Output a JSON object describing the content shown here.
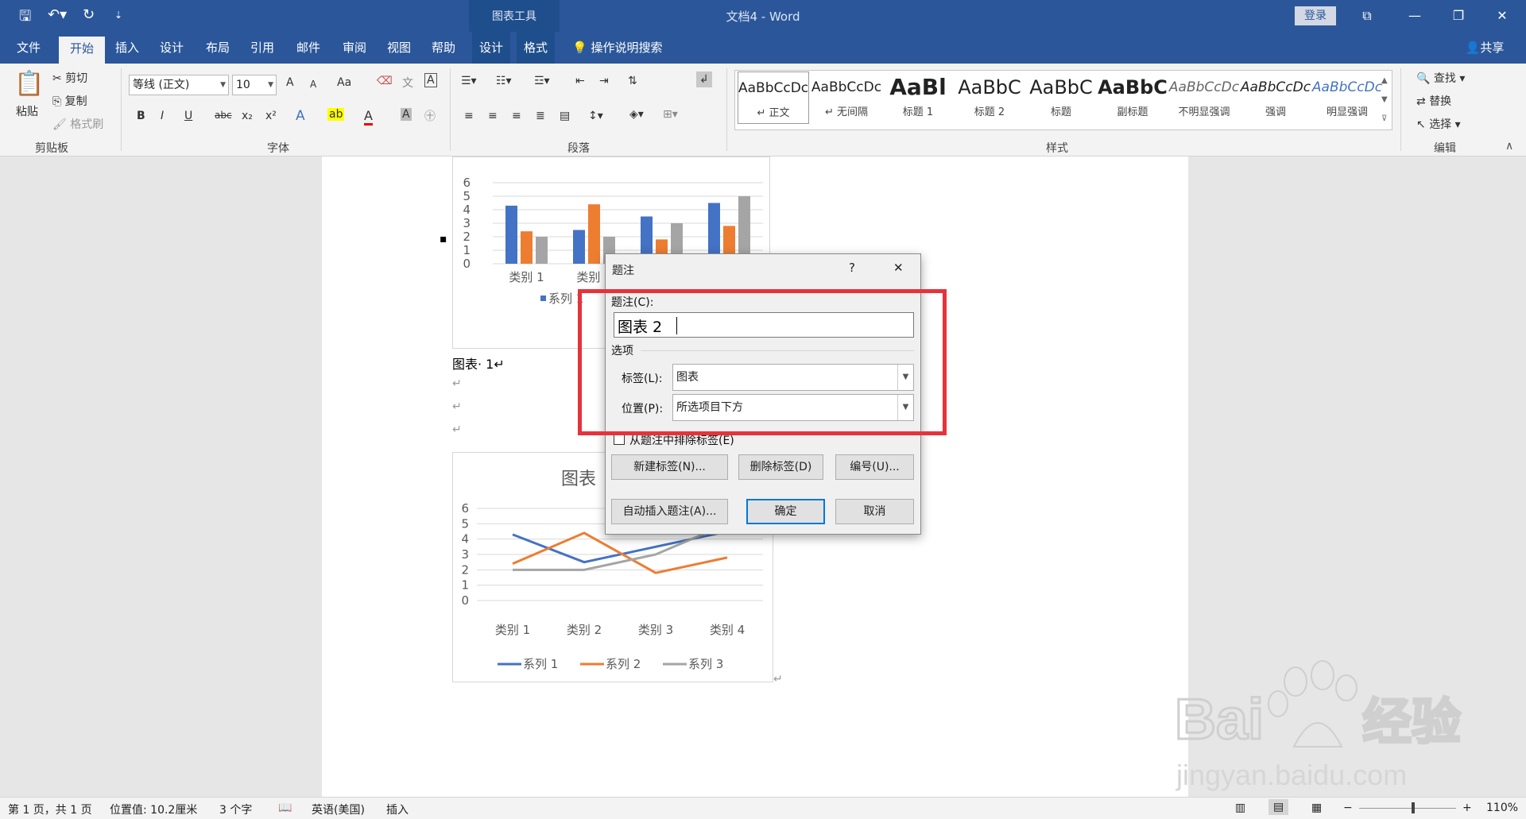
{
  "window": {
    "context_tool_title": "图表工具",
    "doc_title": "文档4  -  Word",
    "login": "登录"
  },
  "tabs": [
    "文件",
    "开始",
    "插入",
    "设计",
    "布局",
    "引用",
    "邮件",
    "审阅",
    "视图",
    "帮助",
    "设计",
    "格式"
  ],
  "tell_me": "操作说明搜索",
  "share": "共享",
  "ribbon": {
    "clipboard": {
      "paste": "粘贴",
      "cut": "剪切",
      "copy": "复制",
      "format_painter": "格式刷",
      "label": "剪贴板"
    },
    "font": {
      "name": "等线 (正文)",
      "size": "10",
      "label": "字体",
      "grow": "A",
      "shrink": "A",
      "case": "Aa",
      "bold": "B",
      "italic": "I",
      "underline": "U",
      "strike": "abc",
      "sub": "x₂",
      "sup": "x²"
    },
    "paragraph": {
      "label": "段落"
    },
    "styles": {
      "label": "样式",
      "items": [
        {
          "preview": "AaBbCcDc",
          "name": "↵ 正文"
        },
        {
          "preview": "AaBbCcDc",
          "name": "↵ 无间隔"
        },
        {
          "preview": "AaBl",
          "name": "标题 1"
        },
        {
          "preview": "AaBbC",
          "name": "标题 2"
        },
        {
          "preview": "AaBbC",
          "name": "标题"
        },
        {
          "preview": "AaBbC",
          "name": "副标题"
        },
        {
          "preview": "AaBbCcDc",
          "name": "不明显强调"
        },
        {
          "preview": "AaBbCcDc",
          "name": "强调"
        },
        {
          "preview": "AaBbCcDc",
          "name": "明显强调"
        }
      ]
    },
    "editing": {
      "find": "查找",
      "replace": "替换",
      "select": "选择",
      "label": "编辑"
    }
  },
  "document": {
    "caption1": "图表· 1↵",
    "chart2_title": "图表",
    "para_mark": "↵",
    "bullet": "▪"
  },
  "chart_data": [
    {
      "type": "bar",
      "categories": [
        "类别 1",
        "类别 2",
        "类别 3",
        "类别 4"
      ],
      "series": [
        {
          "name": "系列 1",
          "values": [
            4.3,
            2.5,
            3.5,
            4.5
          ],
          "color": "#4472c4"
        },
        {
          "name": "系列 2",
          "values": [
            2.4,
            4.4,
            1.8,
            2.8
          ],
          "color": "#ed7d31"
        },
        {
          "name": "系列 3",
          "values": [
            2,
            2,
            3,
            5
          ],
          "color": "#a5a5a5"
        }
      ],
      "yticks": [
        "0",
        "1",
        "2",
        "3",
        "4",
        "5",
        "6"
      ],
      "ylim": [
        0,
        6
      ],
      "legend_visible": [
        "系列 1"
      ]
    },
    {
      "type": "line",
      "title": "图表",
      "categories": [
        "类别 1",
        "类别 2",
        "类别 3",
        "类别 4"
      ],
      "series": [
        {
          "name": "系列 1",
          "values": [
            4.3,
            2.5,
            3.5,
            4.5
          ],
          "color": "#4472c4"
        },
        {
          "name": "系列 2",
          "values": [
            2.4,
            4.4,
            1.8,
            2.8
          ],
          "color": "#ed7d31"
        },
        {
          "name": "系列 3",
          "values": [
            2,
            2,
            3,
            5
          ],
          "color": "#a5a5a5"
        }
      ],
      "yticks": [
        "0",
        "1",
        "2",
        "3",
        "4",
        "5",
        "6"
      ],
      "ylim": [
        0,
        6
      ],
      "legend": "bottom"
    }
  ],
  "dialog": {
    "title": "题注",
    "help": "?",
    "close": "✕",
    "caption_label": "题注(C):",
    "caption_value": "图表 2",
    "options_label": "选项",
    "label_label": "标签(L):",
    "label_value": "图表",
    "position_label": "位置(P):",
    "position_value": "所选项目下方",
    "exclude_label": "从题注中排除标签(E)",
    "new_label": "新建标签(N)...",
    "delete_label": "删除标签(D)",
    "numbering": "编号(U)...",
    "autocaption": "自动插入题注(A)...",
    "ok": "确定",
    "cancel": "取消"
  },
  "statusbar": {
    "page": "第 1 页，共 1 页",
    "position": "位置值: 10.2厘米",
    "words": "3 个字",
    "language": "英语(美国)",
    "mode": "插入",
    "zoom": "110%"
  },
  "watermark": "Baidu经验 jingyan.baidu.com",
  "colors": {
    "brand": "#2b579a",
    "highlight": "#e8323a"
  }
}
